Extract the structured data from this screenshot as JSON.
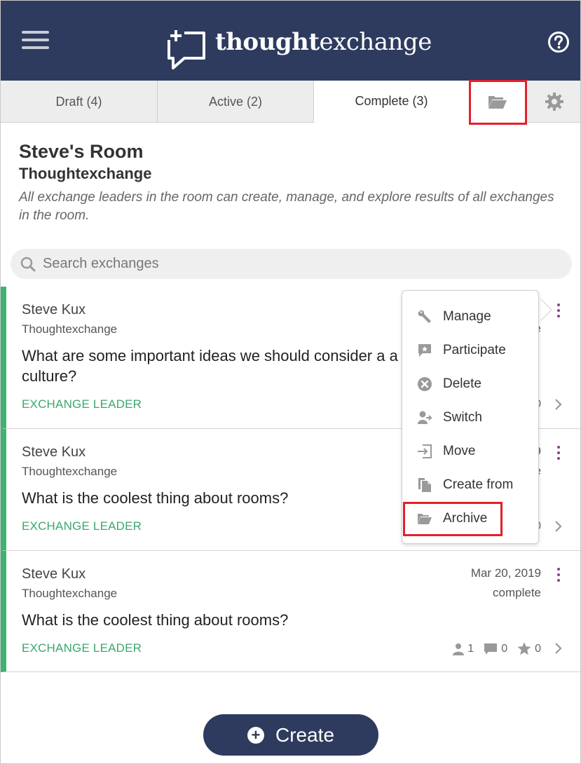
{
  "header": {
    "logo_bold": "thought",
    "logo_regular": "exchange",
    "menu_icon": "hamburger-icon",
    "help_icon": "help-icon",
    "background": "#2e3b5e"
  },
  "tabs": [
    {
      "label": "Draft (4)",
      "active": false
    },
    {
      "label": "Active (2)",
      "active": false
    },
    {
      "label": "Complete (3)",
      "active": true
    }
  ],
  "tab_icons": {
    "archive": "folder-open-icon",
    "settings": "gear-icon"
  },
  "room": {
    "title": "Steve's Room",
    "org": "Thoughtexchange",
    "description": "All exchange leaders in the room can create, manage, and explore results of all exchanges in the room."
  },
  "search": {
    "placeholder": "Search exchanges",
    "icon": "search-icon"
  },
  "exchanges": [
    {
      "author": "Steve Kux",
      "org": "Thoughtexchange",
      "question": "What are some important ideas we should consider a a positive company culture?",
      "role": "EXCHANGE LEADER",
      "date_partial": "e",
      "stat_partial": "0"
    },
    {
      "author": "Steve Kux",
      "org": "Thoughtexchange",
      "question": "What is the coolest thing about rooms?",
      "role": "EXCHANGE LEADER",
      "date_partial": "9",
      "status_partial": "e",
      "stat_partial": "0"
    },
    {
      "author": "Steve Kux",
      "org": "Thoughtexchange",
      "question": "What is the coolest thing about rooms?",
      "role": "EXCHANGE LEADER",
      "date": "Mar 20, 2019",
      "status": "complete",
      "participants": "1",
      "thoughts": "0",
      "stars": "0"
    }
  ],
  "menu": {
    "items": [
      {
        "label": "Manage",
        "icon": "wrench-icon"
      },
      {
        "label": "Participate",
        "icon": "participate-icon"
      },
      {
        "label": "Delete",
        "icon": "delete-icon"
      },
      {
        "label": "Switch",
        "icon": "switch-icon"
      },
      {
        "label": "Move",
        "icon": "move-icon"
      },
      {
        "label": "Create from",
        "icon": "copy-icon"
      },
      {
        "label": "Archive",
        "icon": "folder-open-icon"
      }
    ]
  },
  "create_button": {
    "label": "Create",
    "icon": "plus-circle-icon"
  },
  "colors": {
    "accent_green": "#3cb371",
    "kebab_purple": "#8e3f8e",
    "highlight_red": "#e3202c"
  }
}
